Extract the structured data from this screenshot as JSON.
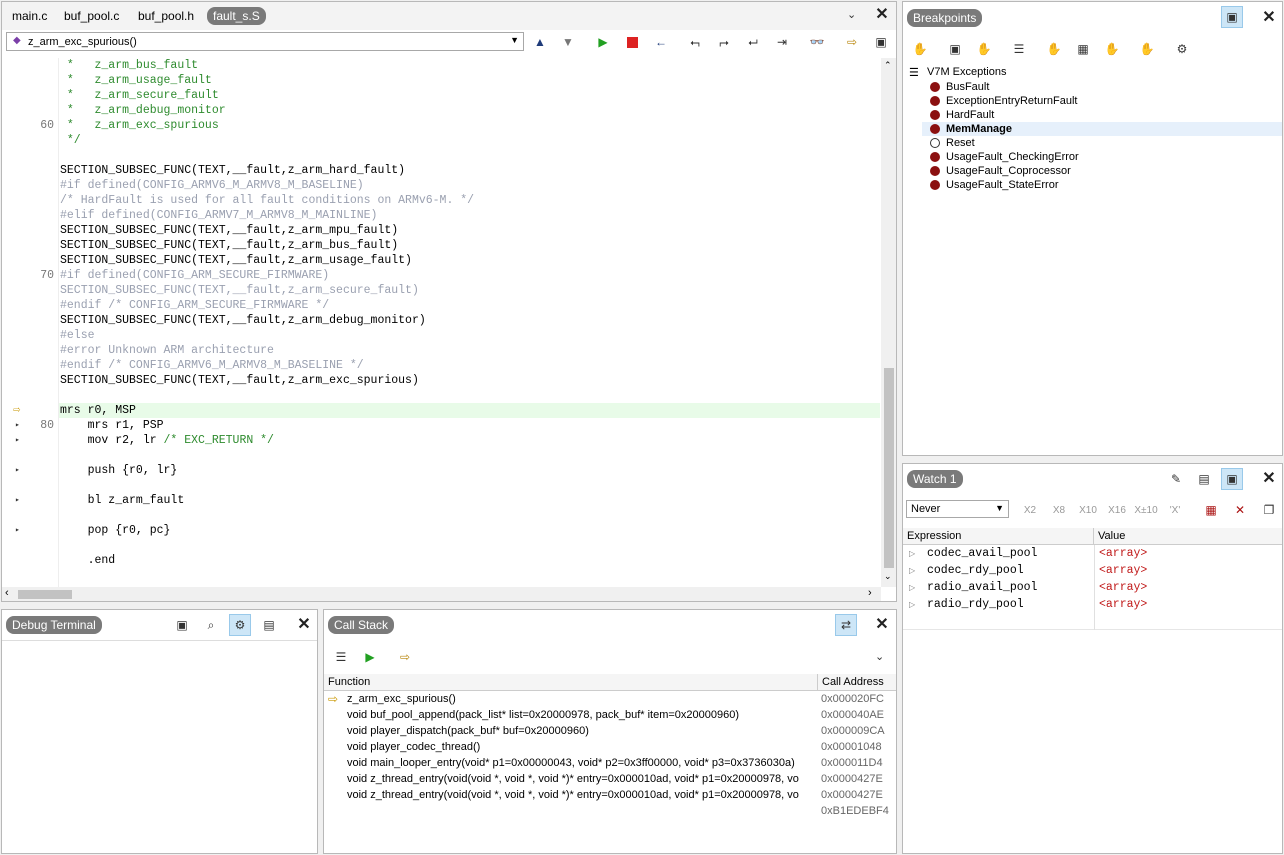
{
  "editor": {
    "tabs": [
      "main.c",
      "buf_pool.c",
      "buf_pool.h",
      "fault_s.S"
    ],
    "function_select": "z_arm_exc_spurious()",
    "lines": [
      {
        "num": "",
        "segments": [
          {
            "t": " *   z_arm_bus_fault",
            "c": "green"
          }
        ]
      },
      {
        "num": "",
        "segments": [
          {
            "t": " *   z_arm_usage_fault",
            "c": "green"
          }
        ]
      },
      {
        "num": "",
        "segments": [
          {
            "t": " *   z_arm_secure_fault",
            "c": "green"
          }
        ]
      },
      {
        "num": "",
        "segments": [
          {
            "t": " *   z_arm_debug_monitor",
            "c": "green"
          }
        ]
      },
      {
        "num": "60",
        "segments": [
          {
            "t": " *   z_arm_exc_spurious",
            "c": "green"
          }
        ]
      },
      {
        "num": "",
        "segments": [
          {
            "t": " */",
            "c": "green"
          }
        ]
      },
      {
        "num": "",
        "segments": []
      },
      {
        "num": "",
        "segments": [
          {
            "t": "SECTION_SUBSEC_FUNC(TEXT,__fault,z_arm_hard_fault)",
            "c": ""
          }
        ]
      },
      {
        "num": "",
        "segments": [
          {
            "t": "#if defined(CONFIG_ARMV6_M_ARMV8_M_BASELINE)",
            "c": "gray"
          }
        ]
      },
      {
        "num": "",
        "segments": [
          {
            "t": "/* HardFault is used for all fault conditions on ARMv6-M. */",
            "c": "gray"
          }
        ]
      },
      {
        "num": "",
        "segments": [
          {
            "t": "#elif defined(CONFIG_ARMV7_M_ARMV8_M_MAINLINE)",
            "c": "gray"
          }
        ]
      },
      {
        "num": "",
        "segments": [
          {
            "t": "SECTION_SUBSEC_FUNC(TEXT,__fault,z_arm_mpu_fault)",
            "c": ""
          }
        ]
      },
      {
        "num": "",
        "segments": [
          {
            "t": "SECTION_SUBSEC_FUNC(TEXT,__fault,z_arm_bus_fault)",
            "c": ""
          }
        ]
      },
      {
        "num": "",
        "segments": [
          {
            "t": "SECTION_SUBSEC_FUNC(TEXT,__fault,z_arm_usage_fault)",
            "c": ""
          }
        ]
      },
      {
        "num": "70",
        "segments": [
          {
            "t": "#if defined(CONFIG_ARM_SECURE_FIRMWARE)",
            "c": "gray"
          }
        ]
      },
      {
        "num": "",
        "segments": [
          {
            "t": "SECTION_SUBSEC_FUNC(TEXT,__fault,z_arm_secure_fault)",
            "c": "gray"
          }
        ]
      },
      {
        "num": "",
        "segments": [
          {
            "t": "#endif /* CONFIG_ARM_SECURE_FIRMWARE */",
            "c": "gray"
          }
        ]
      },
      {
        "num": "",
        "segments": [
          {
            "t": "SECTION_SUBSEC_FUNC(TEXT,__fault,z_arm_debug_monitor)",
            "c": ""
          }
        ]
      },
      {
        "num": "",
        "segments": [
          {
            "t": "#else",
            "c": "gray"
          }
        ]
      },
      {
        "num": "",
        "segments": [
          {
            "t": "#error Unknown ARM architecture",
            "c": "gray"
          }
        ]
      },
      {
        "num": "",
        "segments": [
          {
            "t": "#endif /* CONFIG_ARMV6_M_ARMV8_M_BASELINE */",
            "c": "gray"
          }
        ]
      },
      {
        "num": "",
        "segments": [
          {
            "t": "SECTION_SUBSEC_FUNC(TEXT,__fault,z_arm_exc_spurious)",
            "c": ""
          }
        ]
      },
      {
        "num": "",
        "segments": []
      },
      {
        "num": "",
        "mark": "current",
        "segments": [
          {
            "t": "mrs r0, MSP",
            "c": ""
          }
        ]
      },
      {
        "num": "80",
        "mark": "step",
        "segments": [
          {
            "t": "    mrs r1, PSP",
            "c": ""
          }
        ]
      },
      {
        "num": "",
        "mark": "step",
        "segments": [
          {
            "t": "    mov r2, lr ",
            "c": ""
          },
          {
            "t": "/* EXC_RETURN */",
            "c": "green"
          }
        ]
      },
      {
        "num": "",
        "segments": []
      },
      {
        "num": "",
        "mark": "step",
        "segments": [
          {
            "t": "    push {r0, lr}",
            "c": ""
          }
        ]
      },
      {
        "num": "",
        "segments": []
      },
      {
        "num": "",
        "mark": "step",
        "segments": [
          {
            "t": "    bl z_arm_fault",
            "c": ""
          }
        ]
      },
      {
        "num": "",
        "segments": []
      },
      {
        "num": "",
        "mark": "step",
        "segments": [
          {
            "t": "    pop {r0, pc}",
            "c": ""
          }
        ]
      },
      {
        "num": "",
        "segments": []
      },
      {
        "num": "",
        "segments": [
          {
            "t": "    .end",
            "c": ""
          }
        ]
      }
    ]
  },
  "breakpoints": {
    "title": "Breakpoints",
    "group": "V7M Exceptions",
    "items": [
      {
        "label": "BusFault",
        "enabled": true
      },
      {
        "label": "ExceptionEntryReturnFault",
        "enabled": true
      },
      {
        "label": "HardFault",
        "enabled": true
      },
      {
        "label": "MemManage",
        "enabled": true,
        "selected": true
      },
      {
        "label": "Reset",
        "enabled": false
      },
      {
        "label": "UsageFault_CheckingError",
        "enabled": true
      },
      {
        "label": "UsageFault_Coprocessor",
        "enabled": true
      },
      {
        "label": "UsageFault_StateError",
        "enabled": true
      }
    ]
  },
  "watch": {
    "title": "Watch 1",
    "mode": "Never",
    "format_buttons": [
      "X2",
      "X8",
      "X10",
      "X16",
      "X±10",
      "'X'"
    ],
    "col_expression": "Expression",
    "col_value": "Value",
    "rows": [
      {
        "expr": "codec_avail_pool",
        "value": "<array>"
      },
      {
        "expr": "codec_rdy_pool",
        "value": "<array>"
      },
      {
        "expr": "radio_avail_pool",
        "value": "<array>"
      },
      {
        "expr": "radio_rdy_pool",
        "value": "<array>"
      }
    ]
  },
  "terminal": {
    "title": "Debug Terminal"
  },
  "callstack": {
    "title": "Call Stack",
    "col_function": "Function",
    "col_address": "Call Address",
    "rows": [
      {
        "fn": "z_arm_exc_spurious()",
        "addr": "0x000020FC",
        "current": true
      },
      {
        "fn": "void buf_pool_append(pack_list* list=0x20000978, pack_buf* item=0x20000960)",
        "addr": "0x000040AE"
      },
      {
        "fn": "void player_dispatch(pack_buf* buf=0x20000960)",
        "addr": "0x000009CA"
      },
      {
        "fn": "void player_codec_thread()",
        "addr": "0x00001048"
      },
      {
        "fn": "void main_looper_entry(void* p1=0x00000043, void* p2=0x3ff00000, void* p3=0x3736030a)",
        "addr": "0x000011D4"
      },
      {
        "fn": "void z_thread_entry(void(void *, void *, void *)* entry=0x000010ad, void* p1=0x20000978, vo",
        "addr": "0x0000427E"
      },
      {
        "fn": "void z_thread_entry(void(void *, void *, void *)* entry=0x000010ad, void* p1=0x20000978, vo",
        "addr": "0x0000427E"
      },
      {
        "fn": "",
        "addr": "0xB1EDEBF4"
      }
    ]
  }
}
